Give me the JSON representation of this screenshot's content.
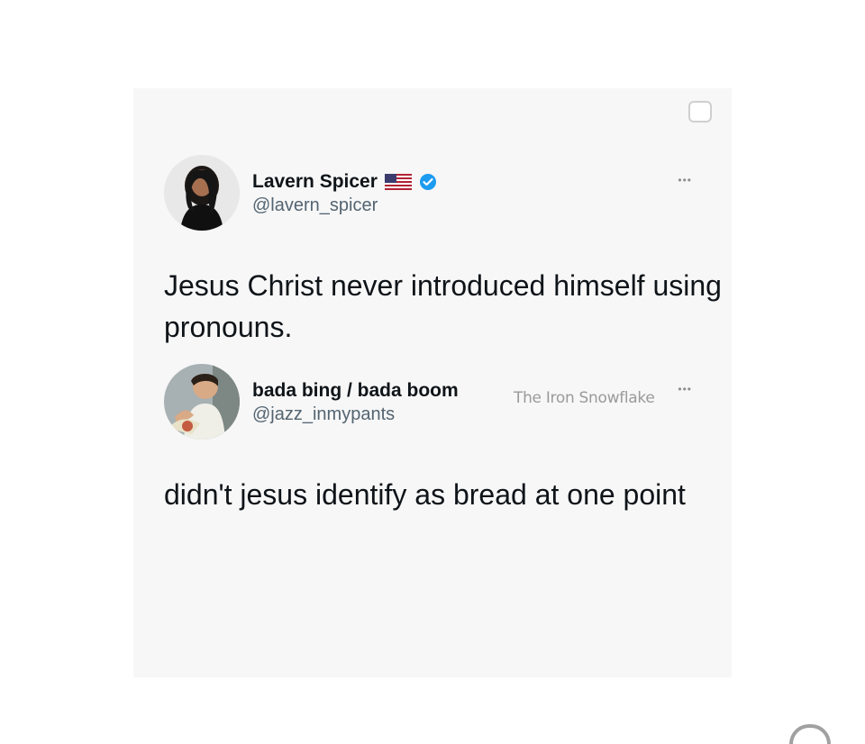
{
  "tweets": [
    {
      "author_name": "Lavern Spicer",
      "handle": "@lavern_spicer",
      "text": "Jesus Christ never introduced himself using pronouns."
    },
    {
      "author_name": "bada bing / bada boom",
      "handle": "@jazz_inmypants",
      "text": "didn't jesus identify as bread at one point"
    }
  ],
  "watermark": "The Iron Snowflake",
  "icons": {
    "flag": "us-flag-icon",
    "verified": "verified-badge-icon",
    "more": "more-options-icon",
    "corner": "square-outline-icon"
  },
  "colors": {
    "card_background": "#f7f7f7",
    "text": "#0f1419",
    "secondary_text": "#536471",
    "verified": "#1d9bf0",
    "watermark": "#9a9a9a"
  }
}
